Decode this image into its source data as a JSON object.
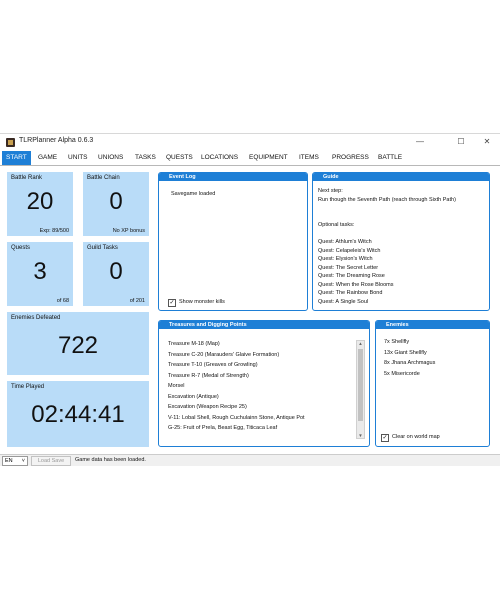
{
  "window": {
    "title": "TLRPlanner Alpha 0.6.3",
    "controls": {
      "minimize": "—",
      "maximize": "☐",
      "close": "✕"
    }
  },
  "menu": [
    "START",
    "GAME",
    "UNITS",
    "UNIONS",
    "TASKS",
    "QUESTS",
    "LOCATIONS",
    "EQUIPMENT",
    "ITEMS",
    "PROGRESS",
    "BATTLE"
  ],
  "tiles": {
    "battle_rank": {
      "label": "Battle Rank",
      "value": "20",
      "sub": "Exp: 89/500"
    },
    "battle_chain": {
      "label": "Battle Chain",
      "value": "0",
      "sub": "No XP bonus"
    },
    "quests": {
      "label": "Quests",
      "value": "3",
      "sub": "of 68"
    },
    "guild_tasks": {
      "label": "Guild Tasks",
      "value": "0",
      "sub": "of 201"
    },
    "enemies_defeated": {
      "label": "Enemies Defeated",
      "value": "722"
    },
    "time_played": {
      "label": "Time Played",
      "value": "02:44:41"
    }
  },
  "event_log": {
    "title": "Event Log",
    "entries": [
      "Savegame loaded"
    ],
    "checkbox_label": "Show monster kills",
    "checked": true
  },
  "guide": {
    "title": "Guide",
    "lines": [
      "Next step:",
      "Run though the Seventh Path (reach through Sixth Path)",
      "",
      "Optional tasks:",
      "",
      "Quest: Athlum's Witch",
      "Quest: Celapeleis's Witch",
      "Quest: Elysion's Witch",
      "Quest: The Secret Letter",
      "Quest: The Dreaming Rose",
      "Quest: When the Rose Blooms",
      "Quest: The Rainbow Bond",
      "Quest: A Single Soul"
    ]
  },
  "treasures": {
    "title": "Treasures and Digging Points",
    "items": [
      "Treasure M-18 (Map)",
      "Treasure C-20 (Marauders' Glaive Formation)",
      "Treasure T-10 (Greaves of Growling)",
      "Treasure R-7 (Medal of Strength)",
      "Morsel",
      "Excavation (Antique)",
      "Excavation (Weapon Recipe 25)",
      "V-11: Lobal Shell, Rough Cuchulainn Stone, Antique Pot",
      "G-25: Fruit of Prela, Beast Egg, Titicaca Leaf"
    ],
    "scroll_up": "▲",
    "scroll_down": "▼"
  },
  "enemies": {
    "title": "Enemies",
    "items": [
      "7x Shellfly",
      "13x Giant Shellfly",
      "8x Jhana Archmagus",
      "5x Misericorde"
    ],
    "checkbox_label": "Clear on world map",
    "checked": true
  },
  "statusbar": {
    "language": "EN",
    "language_arrow": "˅",
    "load_button": "Load Save",
    "message": "Game data has been loaded."
  },
  "colors": {
    "accent": "#1e7fd6",
    "tile_background": "#b9dcf8"
  },
  "icons": {
    "app": "app-icon",
    "checkbox": "checkmark-icon",
    "scroll": "scroll-arrow-icon"
  }
}
